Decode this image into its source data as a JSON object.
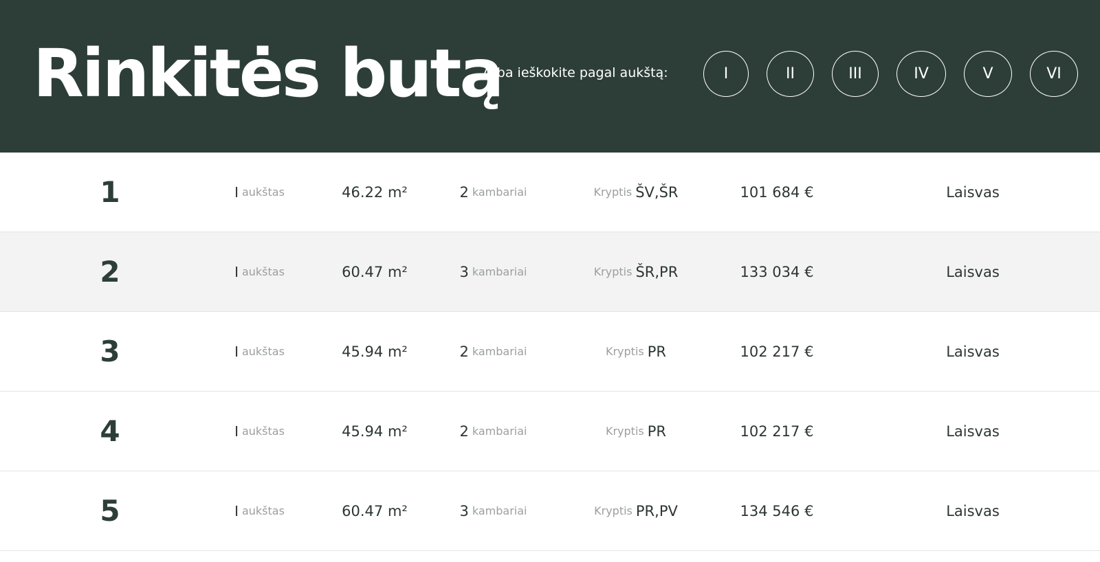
{
  "header": {
    "title": "Rinkitės butą",
    "floor_search_label": "Arba ieškokite pagal aukštą:",
    "floors": [
      "I",
      "II",
      "III",
      "IV",
      "V",
      "VI"
    ]
  },
  "labels": {
    "floor_suffix": "aukštas",
    "rooms_suffix": "kambariai",
    "direction_prefix": "Kryptis"
  },
  "apartments": [
    {
      "number": "1",
      "floor": "I",
      "area": "46.22 m²",
      "rooms": "2",
      "direction": "ŠV,ŠR",
      "price": "101 684 €",
      "status": "Laisvas"
    },
    {
      "number": "2",
      "floor": "I",
      "area": "60.47 m²",
      "rooms": "3",
      "direction": "ŠR,PR",
      "price": "133 034 €",
      "status": "Laisvas"
    },
    {
      "number": "3",
      "floor": "I",
      "area": "45.94 m²",
      "rooms": "2",
      "direction": "PR",
      "price": "102 217 €",
      "status": "Laisvas"
    },
    {
      "number": "4",
      "floor": "I",
      "area": "45.94 m²",
      "rooms": "2",
      "direction": "PR",
      "price": "102 217 €",
      "status": "Laisvas"
    },
    {
      "number": "5",
      "floor": "I",
      "area": "60.47 m²",
      "rooms": "3",
      "direction": "PR,PV",
      "price": "134 546 €",
      "status": "Laisvas"
    }
  ]
}
